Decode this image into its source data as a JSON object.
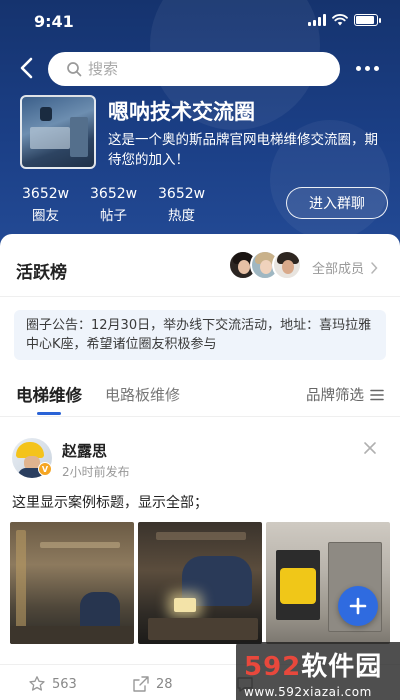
{
  "status_bar": {
    "time": "9:41",
    "battery_level": 0.9
  },
  "search": {
    "placeholder": "搜索"
  },
  "group": {
    "name": "嗯呐技术交流圈",
    "description": "这是一个奥的斯品牌官网电梯维修交流圈，期待您的加入！",
    "join_label": "进入群聊",
    "stats": [
      {
        "value": "3652w",
        "label": "圈友"
      },
      {
        "value": "3652w",
        "label": "帖子"
      },
      {
        "value": "3652w",
        "label": "热度"
      }
    ]
  },
  "active_board": {
    "title": "活跃榜",
    "all_members_label": "全部成员"
  },
  "notice": {
    "text": "圈子公告：12月30日，举办线下交流活动，地址：喜玛拉雅中心K座，希望诸位圈友积极参与"
  },
  "tabs": {
    "items": [
      {
        "label": "电梯维修"
      },
      {
        "label": "电路板维修"
      }
    ],
    "active_index": 0,
    "filter_label": "品牌筛选"
  },
  "post": {
    "author": "赵露思",
    "time": "2小时前发布",
    "title": "这里显示案例标题，显示全部；",
    "likes": "563",
    "shares": "28"
  },
  "watermark": {
    "brand_num": "592",
    "brand_text": "软件园",
    "url": "www.592xiazai.com"
  },
  "colors": {
    "header": "#1b3f86",
    "accent": "#2a63d6",
    "fab": "#2f6be0",
    "notice_bg": "#eff4fb"
  },
  "icons": [
    "back-icon",
    "search-icon",
    "more-icon",
    "chevron-right-icon",
    "menu-lines-icon",
    "close-icon",
    "plus-icon",
    "star-icon",
    "share-icon",
    "comment-icon",
    "verified-badge-icon"
  ]
}
